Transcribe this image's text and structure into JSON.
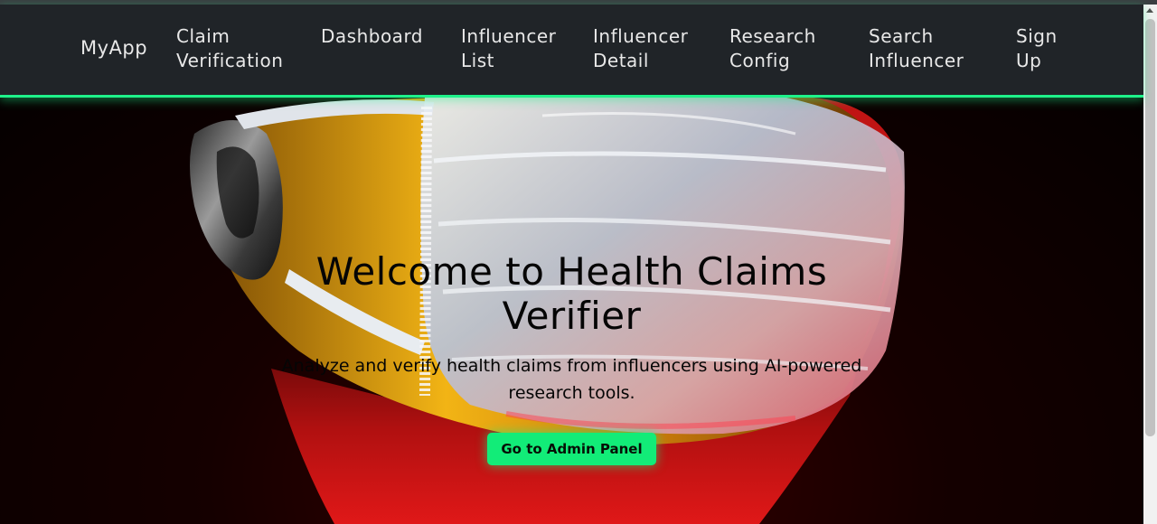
{
  "nav": {
    "brand": "MyApp",
    "links": [
      {
        "line1": "Claim",
        "line2": "Verification"
      },
      {
        "line1": "Dashboard",
        "line2": ""
      },
      {
        "line1": "Influencer",
        "line2": "List"
      },
      {
        "line1": "Influencer",
        "line2": "Detail"
      },
      {
        "line1": "Research",
        "line2": "Config"
      },
      {
        "line1": "Search",
        "line2": "Influencer"
      },
      {
        "line1": "Sign",
        "line2": "Up"
      }
    ]
  },
  "hero": {
    "title": "Welcome to Health Claims Verifier",
    "subtitle": "Analyze and verify health claims from influencers using AI-powered research tools.",
    "cta_label": "Go to Admin Panel",
    "image_name": "surgical-mask-figure"
  },
  "colors": {
    "accent": "#1ef28a",
    "navbar_bg": "#202428",
    "button_bg": "#12ec78",
    "hero_text": "#050505"
  }
}
